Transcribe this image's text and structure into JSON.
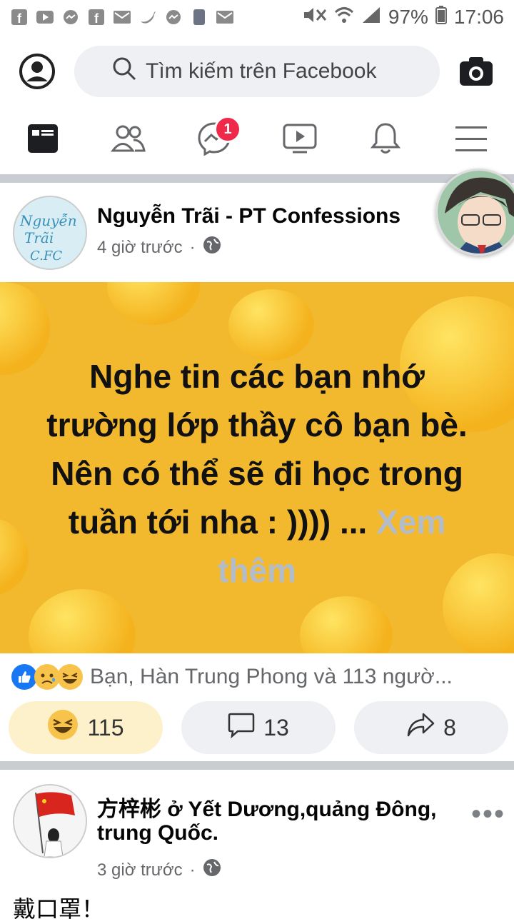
{
  "status": {
    "battery": "97%",
    "time": "17:06"
  },
  "search": {
    "placeholder": "Tìm kiếm trên Facebook"
  },
  "nav": {
    "messenger_badge": "1"
  },
  "post1": {
    "author": "Nguyễn Trãi - PT Confessions",
    "time": "4 giờ trước",
    "text": "Nghe tin các bạn nhớ trường lớp thầy cô bạn bè. Nên có thể sẽ đi học trong tuần tới nha : )))) ...",
    "see_more": "Xem thêm",
    "reactions_summary": "Bạn, Hàn Trung Phong và 113 ngườ...",
    "react_count": "115",
    "comment_count": "13",
    "share_count": "8"
  },
  "post2": {
    "author_line1": "方梓彬 ở Yết Dương,quảng Đông,",
    "author_line2": "trung Quốc.",
    "time": "3 giờ trước",
    "text": "戴口罩！"
  },
  "colors": {
    "accent": "#f02849",
    "like_blue": "#1877f2",
    "post_bg": "#f2b92f"
  }
}
